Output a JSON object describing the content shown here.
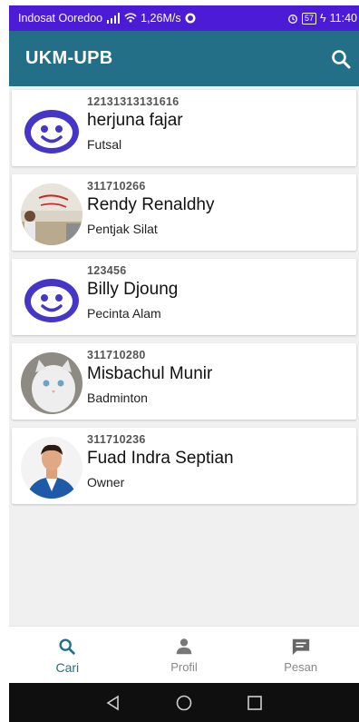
{
  "status_bar": {
    "carrier": "Indosat Ooredoo",
    "network": "4G",
    "speed": "1,26M/s",
    "battery": "57",
    "time": "11:40"
  },
  "app_bar": {
    "title": "UKM-UPB"
  },
  "members": [
    {
      "id": "12131313131616",
      "name": "herjuna fajar",
      "club": "Futsal",
      "avatar": "default-face"
    },
    {
      "id": "311710266",
      "name": "Rendy Renaldhy",
      "club": "Pentjak Silat",
      "avatar": "photo"
    },
    {
      "id": "123456",
      "name": "Billy Djoung",
      "club": "Pecinta Alam",
      "avatar": "default-face"
    },
    {
      "id": "311710280",
      "name": "Misbachul Munir",
      "club": "Badminton",
      "avatar": "photo"
    },
    {
      "id": "311710236",
      "name": "Fuad Indra Septian",
      "club": "Owner",
      "avatar": "photo"
    }
  ],
  "bottom_nav": {
    "items": [
      {
        "label": "Cari",
        "icon": "search-icon",
        "active": true
      },
      {
        "label": "Profil",
        "icon": "person-icon",
        "active": false
      },
      {
        "label": "Pesan",
        "icon": "message-icon",
        "active": false
      }
    ]
  },
  "colors": {
    "status_bar": "#4b1bd6",
    "app_bar": "#236f88",
    "accent": "#236f88",
    "avatar_default": "#4536c8"
  }
}
